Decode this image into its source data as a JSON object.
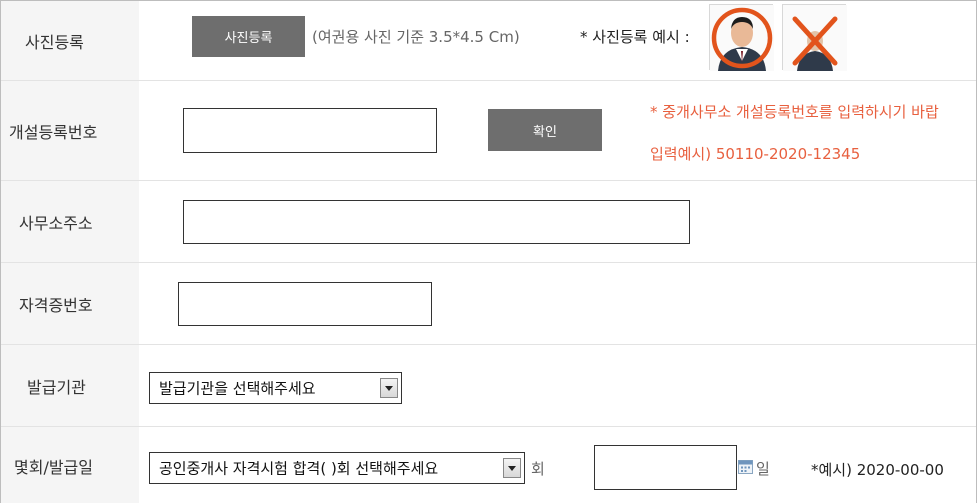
{
  "rows": {
    "photo": {
      "label": "사진등록",
      "button": "사진등록",
      "hint": "(여권용 사진 기준 3.5*4.5 Cm)",
      "example_label": "* 사진등록 예시 :"
    },
    "reg_number": {
      "label": "개설등록번호",
      "confirm_button": "확인",
      "notice": "* 중개사무소 개설등록번호를 입력하시기 바랍",
      "example": "입력예시) 50110-2020-12345"
    },
    "address": {
      "label": "사무소주소"
    },
    "license": {
      "label": "자격증번호"
    },
    "issuer": {
      "label": "발급기관",
      "selected": "발급기관을 선택해주세요"
    },
    "round_date": {
      "label": "몇회/발급일",
      "selected": "공인중개사 자격시험 합격( )회 선택해주세요",
      "round_suffix": "회",
      "day_suffix": "일",
      "example": "*예시) 2020-00-00"
    }
  },
  "icons": {
    "good_example": "person-photo-ok-icon",
    "bad_example": "person-photo-x-icon",
    "calendar": "calendar-icon"
  },
  "colors": {
    "notice": "#e8603f",
    "button": "#6e6e6e",
    "label_bg": "#f5f5f5"
  }
}
